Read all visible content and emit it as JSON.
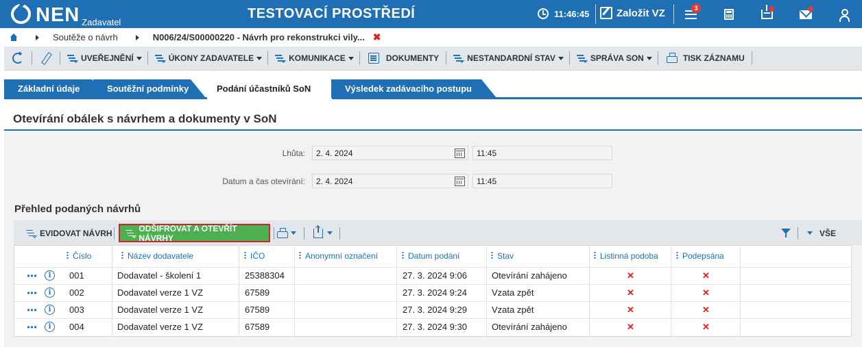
{
  "header": {
    "logo_text": "NEN",
    "logo_sub": "Zadavatel",
    "env_title": "TESTOVACÍ PROSTŘEDÍ",
    "clock": "11:46:45",
    "create_label": "Založit VZ",
    "notifications_count": "3",
    "colors": {
      "brand": "#1f6fb5",
      "badge": "#e53935"
    }
  },
  "breadcrumb": {
    "items": [
      "Soutěže o návrh",
      "N006/24/S00000220 - Návrh pro rekonstrukci vily..."
    ],
    "close_symbol": "✖"
  },
  "toolbar": {
    "items": [
      {
        "label": "UVEŘEJNĚNÍ",
        "icon": "list-arrow-icon",
        "dropdown": true
      },
      {
        "label": "ÚKONY ZADAVATELE",
        "icon": "list-arrow-icon",
        "dropdown": true
      },
      {
        "label": "KOMUNIKACE",
        "icon": "list-arrow-icon",
        "dropdown": true
      },
      {
        "label": "DOKUMENTY",
        "icon": "document-icon",
        "dropdown": false
      },
      {
        "label": "NESTANDARDNÍ STAV",
        "icon": "list-arrow-icon",
        "dropdown": true
      },
      {
        "label": "SPRÁVA SON",
        "icon": "list-arrow-icon",
        "dropdown": true
      },
      {
        "label": "TISK ZÁZNAMU",
        "icon": "print-icon",
        "dropdown": false
      }
    ]
  },
  "tabs": [
    {
      "label": "Základní údaje",
      "active": false
    },
    {
      "label": "Soutěžní podmínky",
      "active": false
    },
    {
      "label": "Podání účastníků SoN",
      "active": true
    },
    {
      "label": "Výsledek zadávacího postupu",
      "active": false
    }
  ],
  "section": {
    "title": "Otevírání obálek s návrhem a dokumenty v SoN",
    "fields": {
      "deadline": {
        "label": "Lhůta:",
        "date": "2. 4. 2024",
        "time": "11:45"
      },
      "opening": {
        "label": "Datum a čas otevírání:",
        "date": "2. 4. 2024",
        "time": "11:45"
      }
    }
  },
  "proposals": {
    "title": "Přehled podaných návrhů",
    "toolbar": {
      "register_label": "EVIDOVAT NÁVRH",
      "decrypt_label": "ODŠIFROVAT A OTEVŘÍT NÁVRHY",
      "all_label": "VŠE"
    },
    "columns": [
      "Číslo",
      "Název dodavatele",
      "IČO",
      "Anonymní označení",
      "Datum podání",
      "Stav",
      "Listinná podoba",
      "Podepsána"
    ],
    "rows": [
      {
        "number": "001",
        "supplier": "Dodavatel - školení 1",
        "ico": "25388304",
        "anon": "",
        "date": "27. 3. 2024 9:06",
        "status": "Otevírání zahájeno",
        "paper": "✕",
        "signed": "✕"
      },
      {
        "number": "002",
        "supplier": "Dodavatel verze 1 VZ",
        "ico": "67589",
        "anon": "",
        "date": "27. 3. 2024 9:24",
        "status": "Vzata zpět",
        "paper": "✕",
        "signed": "✕"
      },
      {
        "number": "003",
        "supplier": "Dodavatel verze 1 VZ",
        "ico": "67589",
        "anon": "",
        "date": "27. 3. 2024 9:29",
        "status": "Vzata zpět",
        "paper": "✕",
        "signed": "✕"
      },
      {
        "number": "004",
        "supplier": "Dodavatel verze 1 VZ",
        "ico": "67589",
        "anon": "",
        "date": "27. 3. 2024 9:30",
        "status": "Otevírání zahájeno",
        "paper": "✕",
        "signed": "✕"
      }
    ]
  }
}
